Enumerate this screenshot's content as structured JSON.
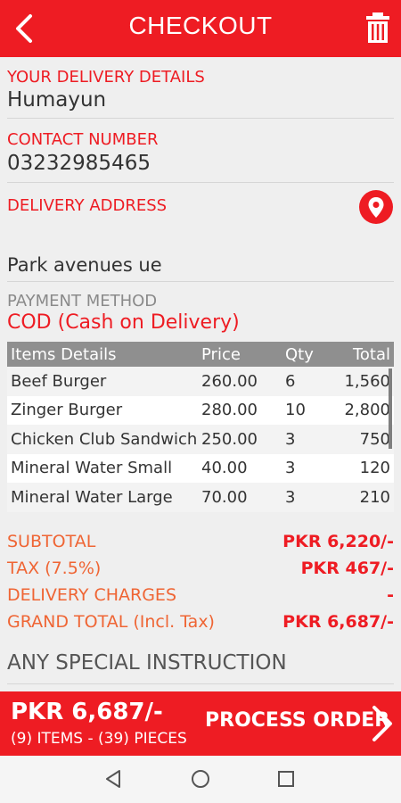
{
  "header": {
    "title": "CHECKOUT",
    "back_icon": "back-arrow-icon",
    "trash_icon": "trash-icon"
  },
  "delivery": {
    "name_label": "YOUR DELIVERY DETAILS",
    "name_value": "Humayun",
    "contact_label": "CONTACT NUMBER",
    "contact_value": "03232985465",
    "address_label": "DELIVERY ADDRESS",
    "address_value": "Park avenues ue",
    "location_icon": "location-pin-icon"
  },
  "payment": {
    "label": "PAYMENT METHOD",
    "value": "COD (Cash on Delivery)"
  },
  "items_table": {
    "headers": [
      "Items Details",
      "Price",
      "Qty",
      "Total"
    ],
    "rows": [
      {
        "name": "Beef Burger",
        "price": "260.00",
        "qty": "6",
        "total": "1,560"
      },
      {
        "name": "Zinger Burger",
        "price": "280.00",
        "qty": "10",
        "total": "2,800"
      },
      {
        "name": "Chicken Club Sandwich",
        "price": "250.00",
        "qty": "3",
        "total": "750"
      },
      {
        "name": "Mineral Water Small",
        "price": "40.00",
        "qty": "3",
        "total": "120"
      },
      {
        "name": "Mineral Water Large",
        "price": "70.00",
        "qty": "3",
        "total": "210"
      }
    ]
  },
  "summary": {
    "subtotal_label": "SUBTOTAL",
    "subtotal_value": "PKR 6,220/-",
    "tax_label": "TAX (7.5%)",
    "tax_value": "PKR 467/-",
    "delivery_label": "DELIVERY CHARGES",
    "delivery_value": "-",
    "grand_label": "GRAND TOTAL (Incl. Tax)",
    "grand_value": "PKR 6,687/-"
  },
  "special_instruction": {
    "placeholder": "ANY SPECIAL INSTRUCTION"
  },
  "footer": {
    "total": "PKR 6,687/-",
    "counts": "(9) ITEMS - (39) PIECES",
    "process_label": "PROCESS ORDER",
    "process_icon": "chevron-right-icon"
  },
  "colors": {
    "accent": "#ee1c23",
    "summary_label": "#ef6534",
    "table_header": "#8f8f8f"
  }
}
